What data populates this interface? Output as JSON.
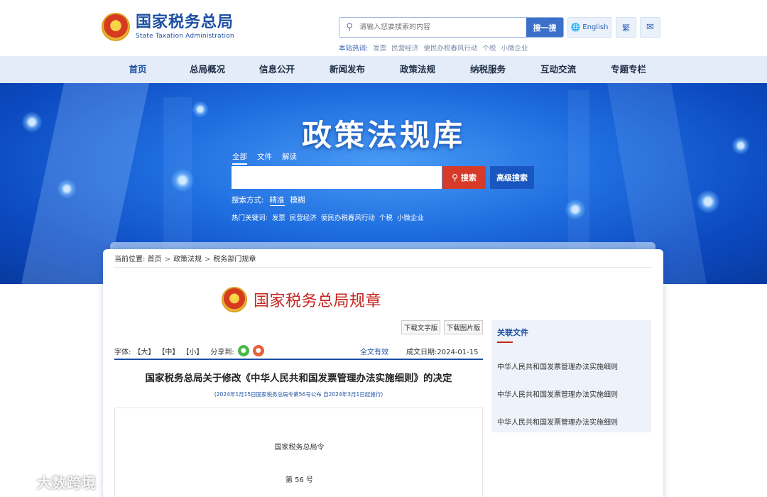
{
  "header": {
    "logo_cn": "国家税务总局",
    "logo_en": "State Taxation Administration",
    "search_placeholder": "请输入您要搜索的内容",
    "search_button": "搜一搜",
    "hotwords_label": "本站热词:",
    "hotwords": [
      "发票",
      "民营经济",
      "便民办税春风行动",
      "个税",
      "小微企业"
    ],
    "english_label": "English",
    "traditional_label": "繁"
  },
  "nav": {
    "items": [
      "首页",
      "总局概况",
      "信息公开",
      "新闻发布",
      "政策法规",
      "纳税服务",
      "互动交流",
      "专题专栏"
    ]
  },
  "banner": {
    "title": "政策法规库",
    "tabs": [
      "全部",
      "文件",
      "解读"
    ],
    "search_button": "搜索",
    "advanced_button": "高级搜索",
    "mode_label": "搜索方式:",
    "modes": [
      "精准",
      "模糊"
    ],
    "hot_label": "热门关键词:",
    "hotwords": [
      "发票",
      "民营经济",
      "便民办税春风行动",
      "个税",
      "小微企业"
    ]
  },
  "breadcrumb": {
    "label": "当前位置:",
    "items": [
      "首页",
      "政策法规",
      "税务部门规章"
    ]
  },
  "article": {
    "reg_header": "国家税务总局规章",
    "download_text": "下载文字版",
    "download_image": "下载图片版",
    "font_label": "字体:",
    "font_sizes": [
      "【大】",
      "【中】",
      "【小】"
    ],
    "share_label": "分享到:",
    "validity": "全文有效",
    "date_label": "成文日期:",
    "date": "2024-01-15",
    "title": "国家税务总局关于修改《中华人民共和国发票管理办法实施细则》的决定",
    "subtitle": "(2024年1月15日国家税务总局令第56号公布 自2024年3月1日起施行)",
    "body_line1": "国家税务总局令",
    "body_line2": "第 56 号"
  },
  "related": {
    "title": "关联文件",
    "items": [
      "中华人民共和国发票管理办法实施细则",
      "中华人民共和国发票管理办法实施细则",
      "中华人民共和国发票管理办法实施细则"
    ]
  },
  "watermark": {
    "text": "大数跨境"
  },
  "colors": {
    "brand_blue": "#1d4fa3",
    "brand_red": "#c4251f",
    "nav_bg": "#e3ecf8"
  }
}
